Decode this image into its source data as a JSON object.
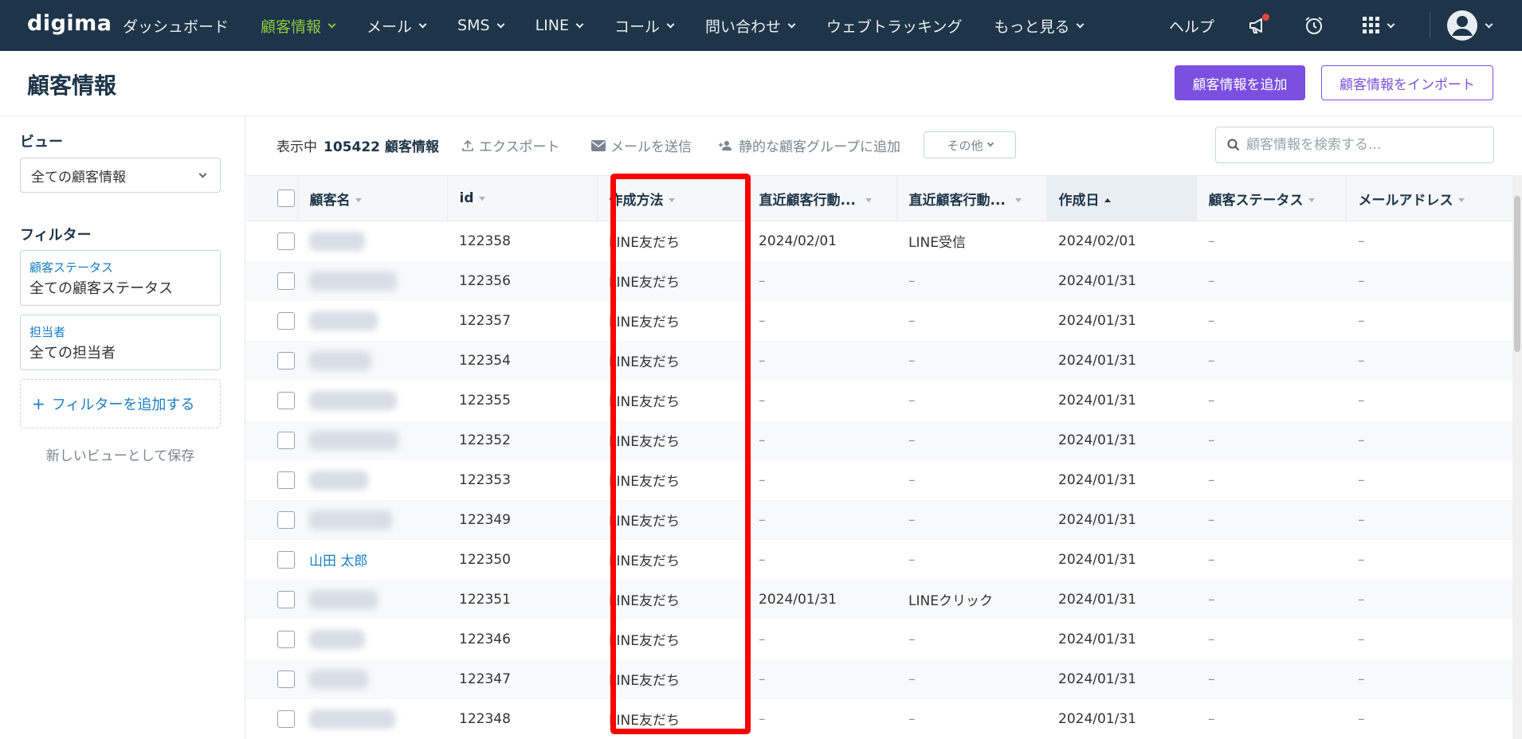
{
  "app": {
    "logo": "digima",
    "nav": [
      {
        "label": "ダッシュボード",
        "dropdown": false
      },
      {
        "label": "顧客情報",
        "dropdown": true,
        "active": true
      },
      {
        "label": "メール",
        "dropdown": true
      },
      {
        "label": "SMS",
        "dropdown": true
      },
      {
        "label": "LINE",
        "dropdown": true
      },
      {
        "label": "コール",
        "dropdown": true
      },
      {
        "label": "問い合わせ",
        "dropdown": true
      },
      {
        "label": "ウェブトラッキング",
        "dropdown": false
      },
      {
        "label": "もっと見る",
        "dropdown": true
      }
    ],
    "help": "ヘルプ",
    "colors": {
      "nav_bg": "#1e3448",
      "active": "#8cc63f",
      "primary": "#7b4fe0",
      "link": "#1a7ec2",
      "highlight": "#ff0000"
    }
  },
  "page": {
    "title": "顧客情報",
    "add_button": "顧客情報を追加",
    "import_button": "顧客情報をインポート"
  },
  "sidebar": {
    "view_label": "ビュー",
    "view_value": "全ての顧客情報",
    "filter_label": "フィルター",
    "filters": [
      {
        "key": "顧客ステータス",
        "value": "全ての顧客ステータス"
      },
      {
        "key": "担当者",
        "value": "全ての担当者"
      }
    ],
    "add_filter": "フィルターを追加する",
    "save_view": "新しいビューとして保存"
  },
  "toolbar": {
    "showing_label": "表示中",
    "count": "105422 顧客情報",
    "export": "エクスポート",
    "send_mail": "メールを送信",
    "add_group": "静的な顧客グループに追加",
    "more": "その他",
    "search_placeholder": "顧客情報を検索する..."
  },
  "table": {
    "columns": [
      "顧客名",
      "id",
      "作成方法",
      "直近顧客行動...",
      "直近顧客行動...",
      "作成日",
      "顧客ステータス",
      "メールアドレス"
    ],
    "sorted_column": "作成日",
    "rows": [
      {
        "name": "",
        "id": "122358",
        "method": "LINE友だち",
        "last_date": "2024/02/01",
        "last_action": "LINE受信",
        "created": "2024/02/01",
        "status": "–",
        "email": "–"
      },
      {
        "name": "",
        "id": "122356",
        "method": "LINE友だち",
        "last_date": "–",
        "last_action": "–",
        "created": "2024/01/31",
        "status": "–",
        "email": "–"
      },
      {
        "name": "",
        "id": "122357",
        "method": "LINE友だち",
        "last_date": "–",
        "last_action": "–",
        "created": "2024/01/31",
        "status": "–",
        "email": "–"
      },
      {
        "name": "",
        "id": "122354",
        "method": "LINE友だち",
        "last_date": "–",
        "last_action": "–",
        "created": "2024/01/31",
        "status": "–",
        "email": "–"
      },
      {
        "name": "",
        "id": "122355",
        "method": "LINE友だち",
        "last_date": "–",
        "last_action": "–",
        "created": "2024/01/31",
        "status": "–",
        "email": "–"
      },
      {
        "name": "",
        "id": "122352",
        "method": "LINE友だち",
        "last_date": "–",
        "last_action": "–",
        "created": "2024/01/31",
        "status": "–",
        "email": "–"
      },
      {
        "name": "",
        "id": "122353",
        "method": "LINE友だち",
        "last_date": "–",
        "last_action": "–",
        "created": "2024/01/31",
        "status": "–",
        "email": "–"
      },
      {
        "name": "",
        "id": "122349",
        "method": "LINE友だち",
        "last_date": "–",
        "last_action": "–",
        "created": "2024/01/31",
        "status": "–",
        "email": "–"
      },
      {
        "name": "山田 太郎",
        "id": "122350",
        "method": "LINE友だち",
        "last_date": "–",
        "last_action": "–",
        "created": "2024/01/31",
        "status": "–",
        "email": "–"
      },
      {
        "name": "",
        "id": "122351",
        "method": "LINE友だち",
        "last_date": "2024/01/31",
        "last_action": "LINEクリック",
        "created": "2024/01/31",
        "status": "–",
        "email": "–"
      },
      {
        "name": "",
        "id": "122346",
        "method": "LINE友だち",
        "last_date": "–",
        "last_action": "–",
        "created": "2024/01/31",
        "status": "–",
        "email": "–"
      },
      {
        "name": "",
        "id": "122347",
        "method": "LINE友だち",
        "last_date": "–",
        "last_action": "–",
        "created": "2024/01/31",
        "status": "–",
        "email": "–"
      },
      {
        "name": "",
        "id": "122348",
        "method": "LINE友だち",
        "last_date": "–",
        "last_action": "–",
        "created": "2024/01/31",
        "status": "–",
        "email": "–"
      }
    ]
  }
}
